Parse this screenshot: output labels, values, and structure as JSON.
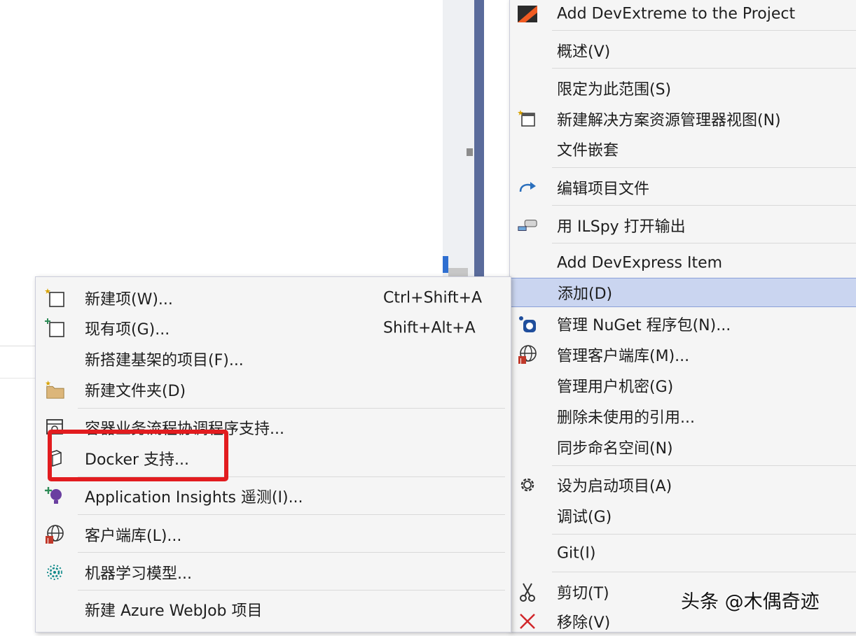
{
  "context_menu": {
    "items": [
      {
        "label": "Add DevExtreme to the Project",
        "icon": "devextreme-icon"
      },
      {
        "label": "概述(V)"
      },
      {
        "label": "限定为此范围(S)"
      },
      {
        "label": "新建解决方案资源管理器视图(N)",
        "icon": "new-view-icon"
      },
      {
        "label": "文件嵌套"
      },
      {
        "label": "编辑项目文件",
        "icon": "redo-arrow-icon"
      },
      {
        "label": "用 ILSpy 打开输出",
        "icon": "ilspy-icon"
      },
      {
        "label": "Add DevExpress Item"
      },
      {
        "label": "添加(D)",
        "highlighted": true
      },
      {
        "label": "管理 NuGet 程序包(N)...",
        "icon": "nuget-icon"
      },
      {
        "label": "管理客户端库(M)...",
        "icon": "client-library-icon"
      },
      {
        "label": "管理用户机密(G)"
      },
      {
        "label": "删除未使用的引用..."
      },
      {
        "label": "同步命名空间(N)"
      },
      {
        "label": "设为启动项目(A)",
        "icon": "gear-icon"
      },
      {
        "label": "调试(G)"
      },
      {
        "label": "Git(I)"
      },
      {
        "label": "剪切(T)",
        "icon": "scissors-icon"
      },
      {
        "label": "移除(V)",
        "icon": "delete-x-icon"
      }
    ]
  },
  "add_submenu": {
    "items": [
      {
        "label": "新建项(W)...",
        "shortcut": "Ctrl+Shift+A",
        "icon": "new-item-icon"
      },
      {
        "label": "现有项(G)...",
        "shortcut": "Shift+Alt+A",
        "icon": "existing-item-icon"
      },
      {
        "label": "新搭建基架的项目(F)..."
      },
      {
        "label": "新建文件夹(D)",
        "icon": "new-folder-icon"
      },
      {
        "label": "容器业务流程协调程序支持...",
        "icon": "container-icon"
      },
      {
        "label": "Docker 支持...",
        "icon": "docker-icon"
      },
      {
        "label": "Application Insights 遥测(I)...",
        "icon": "insights-icon"
      },
      {
        "label": "客户端库(L)...",
        "icon": "client-library-icon"
      },
      {
        "label": "机器学习模型...",
        "icon": "ml-model-icon"
      },
      {
        "label": "新建 Azure WebJob 项目"
      }
    ]
  },
  "watermark": "头条 @木偶奇迹",
  "colors": {
    "menu_bg": "#f5f5f5",
    "highlight_bg": "#cad5f0",
    "highlight_border": "#8aa0d8",
    "annotation_red": "#e21c1f",
    "navy_bar": "#5a6b9b"
  }
}
